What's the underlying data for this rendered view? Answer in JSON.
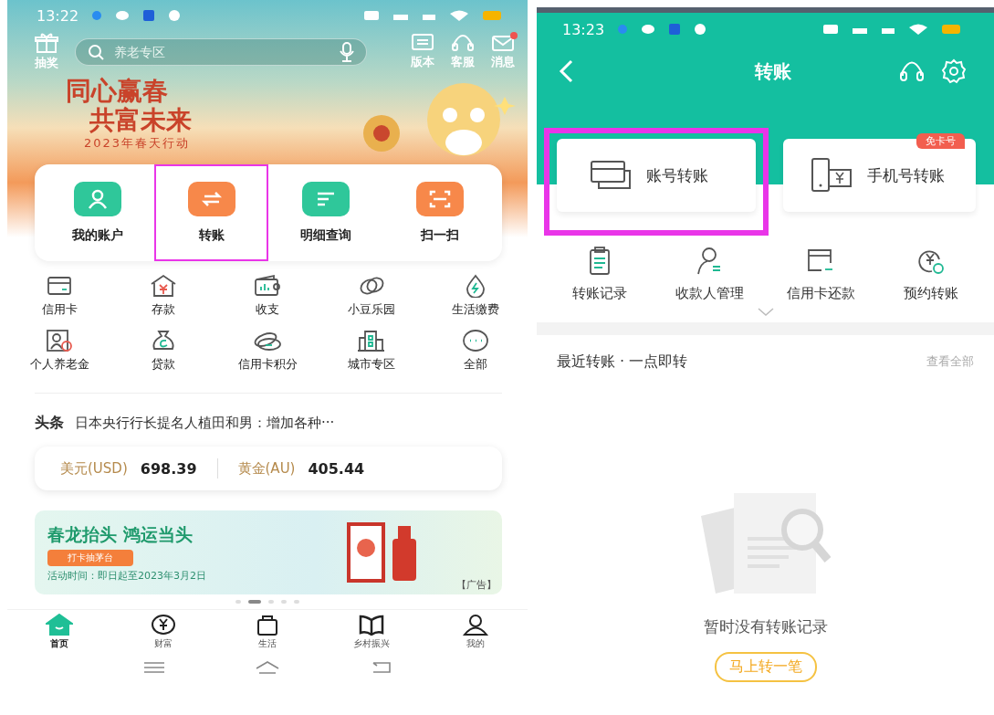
{
  "left_screen": {
    "status_bar": {
      "time": "13:22"
    },
    "header": {
      "lottery_label": "抽奖",
      "search": {
        "placeholder": "养老专区"
      },
      "actions": [
        {
          "label": "版本",
          "badge": false
        },
        {
          "label": "客服",
          "badge": false
        },
        {
          "label": "消息",
          "badge": true
        }
      ]
    },
    "hero_banner": {
      "lines": [
        "同心赢春",
        "共富未来"
      ],
      "subtitle": "2023年春天行动"
    },
    "quick_actions": [
      {
        "label": "我的账户",
        "color": "#2fc79a",
        "highlighted": false
      },
      {
        "label": "转账",
        "color": "#f7884a",
        "highlighted": true
      },
      {
        "label": "明细查询",
        "color": "#2fc79a",
        "highlighted": false
      },
      {
        "label": "扫一扫",
        "color": "#f7884a",
        "highlighted": false
      }
    ],
    "services": [
      {
        "label": "信用卡"
      },
      {
        "label": "存款"
      },
      {
        "label": "收支"
      },
      {
        "label": "小豆乐园"
      },
      {
        "label": "生活缴费"
      },
      {
        "label": "个人养老金"
      },
      {
        "label": "贷款"
      },
      {
        "label": "信用卡积分"
      },
      {
        "label": "城市专区"
      },
      {
        "label": "全部"
      }
    ],
    "headline": {
      "tag": "头条",
      "text": "日本央行行长提名人植田和男：增加各种···"
    },
    "rates": [
      {
        "label": "美元(USD)",
        "value": "698.39"
      },
      {
        "label": "黄金(AU)",
        "value": "405.44"
      }
    ],
    "ad_banner": {
      "title": "春龙抬头 鸿运当头",
      "button": "打卡抽茅台",
      "note": "活动时间：即日起至2023年3月2日",
      "tag": "【广告】"
    },
    "carousel_dots": [
      {
        "selected": false
      },
      {
        "selected": true
      },
      {
        "selected": false
      },
      {
        "selected": false
      },
      {
        "selected": false
      }
    ],
    "tab_bar": [
      {
        "label": "首页",
        "selected": true
      },
      {
        "label": "财富",
        "selected": false
      },
      {
        "label": "生活",
        "selected": false
      },
      {
        "label": "乡村振兴",
        "selected": false
      },
      {
        "label": "我的",
        "selected": false
      }
    ]
  },
  "right_screen": {
    "status_bar": {
      "time": "13:23"
    },
    "title": "转账",
    "transfer_options": [
      {
        "label": "账号转账",
        "highlighted": true
      },
      {
        "label": "手机号转账",
        "badge": "免卡号",
        "highlighted": false
      }
    ],
    "tools": [
      {
        "label": "转账记录"
      },
      {
        "label": "收款人管理"
      },
      {
        "label": "信用卡还款"
      },
      {
        "label": "预约转账"
      }
    ],
    "recent": {
      "title": "最近转账 · 一点即转",
      "link": "查看全部",
      "empty_text": "暂时没有转账记录",
      "button": "马上转一笔"
    }
  }
}
